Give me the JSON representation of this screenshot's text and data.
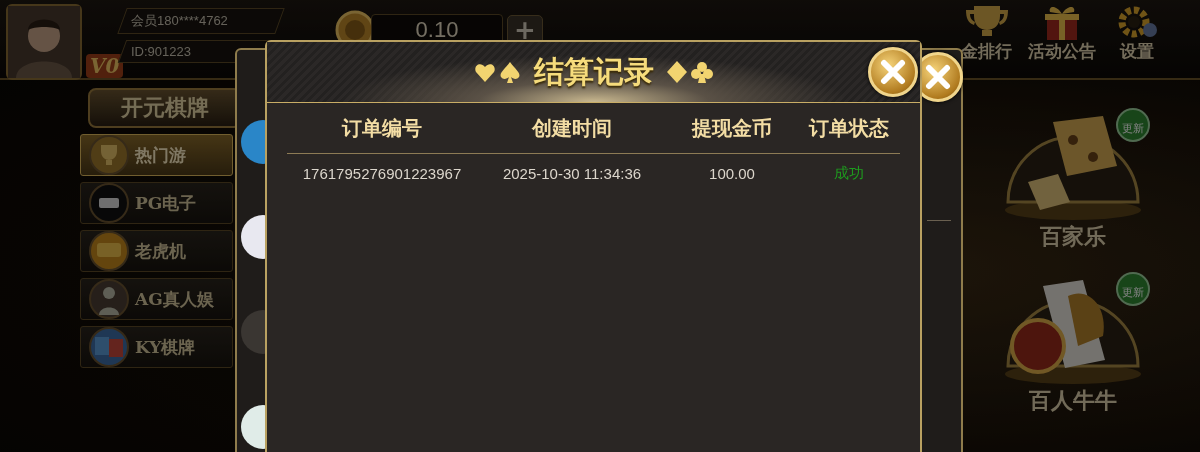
{
  "profile": {
    "member": "会员180****4762",
    "id": "ID:901223",
    "vip": "V0"
  },
  "balance": {
    "amount": "0.10",
    "add": "+"
  },
  "top_menu": [
    {
      "label": "金排行",
      "kind": "trophy"
    },
    {
      "label": "活动公告",
      "kind": "gift"
    },
    {
      "label": "设置",
      "kind": "gear"
    }
  ],
  "brand": "开元棋牌",
  "categories": [
    {
      "label": "热门游",
      "kind": "trophy",
      "selected": true
    },
    {
      "label": "PG电子",
      "kind": "pg",
      "selected": false
    },
    {
      "label": "老虎机",
      "kind": "slot",
      "selected": false
    },
    {
      "label": "AG真人娱",
      "kind": "figure",
      "selected": false
    },
    {
      "label": "KY棋牌",
      "kind": "ky",
      "selected": false
    }
  ],
  "games": [
    {
      "name": "百家乐",
      "kind": "dice",
      "badge": "更新"
    },
    {
      "name": "百人牛牛",
      "kind": "cards",
      "badge": "更新"
    }
  ],
  "dialog": {
    "title": "结算记录",
    "columns": [
      "订单编号",
      "创建时间",
      "提现金币",
      "订单状态"
    ],
    "rows": [
      {
        "order_no": "1761795276901223967",
        "created": "2025-10-30 11:34:36",
        "amount": "100.00",
        "status": "成功",
        "color": "#1e9a1e"
      }
    ]
  }
}
